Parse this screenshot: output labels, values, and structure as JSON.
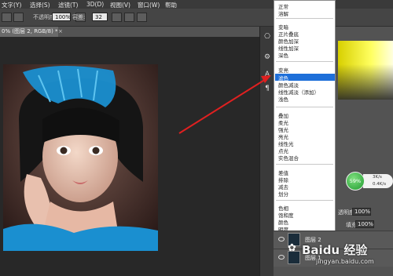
{
  "menubar": {
    "items": [
      "文字(Y)",
      "选择(S)",
      "滤镜(T)",
      "3D(D)",
      "视图(V)",
      "窗口(W)",
      "帮助"
    ]
  },
  "options_bar": {
    "mode_label": "不透明度:",
    "opacity_value": "100%",
    "flow_label": "容差:",
    "flow_value": "32"
  },
  "document_tab": {
    "title": "0% (图层 2, RGB/8) *",
    "close": "×"
  },
  "blend_menu": {
    "groups": [
      [
        "正常",
        "溶解"
      ],
      [
        "变暗",
        "正片叠底",
        "颜色加深",
        "线性加深",
        "深色"
      ],
      [
        "变亮",
        "滤色",
        "颜色减淡",
        "线性减淡（添加）",
        "浅色"
      ],
      [
        "叠加",
        "柔光",
        "强光",
        "亮光",
        "线性光",
        "点光",
        "实色混合"
      ],
      [
        "差值",
        "排除",
        "减去",
        "划分"
      ],
      [
        "色相",
        "饱和度",
        "颜色",
        "明度"
      ]
    ],
    "selected": "滤色"
  },
  "layers": {
    "opacity_label": "透明度:",
    "opacity_value": "100%",
    "fill_label": "填充:",
    "fill_value": "100%",
    "rows": [
      {
        "name": "图层 2"
      },
      {
        "name": "图层 1"
      }
    ]
  },
  "speed_widget": {
    "percent": "59%",
    "up": "3K/s",
    "down": "0.4K/s"
  },
  "watermark": {
    "brand": "Baidu 经验",
    "url": "jingyan.baidu.com"
  },
  "colors": {
    "menu_highlight": "#1e6fd9",
    "arrow": "#e02020",
    "photo_accent": "#1a8fd0"
  }
}
